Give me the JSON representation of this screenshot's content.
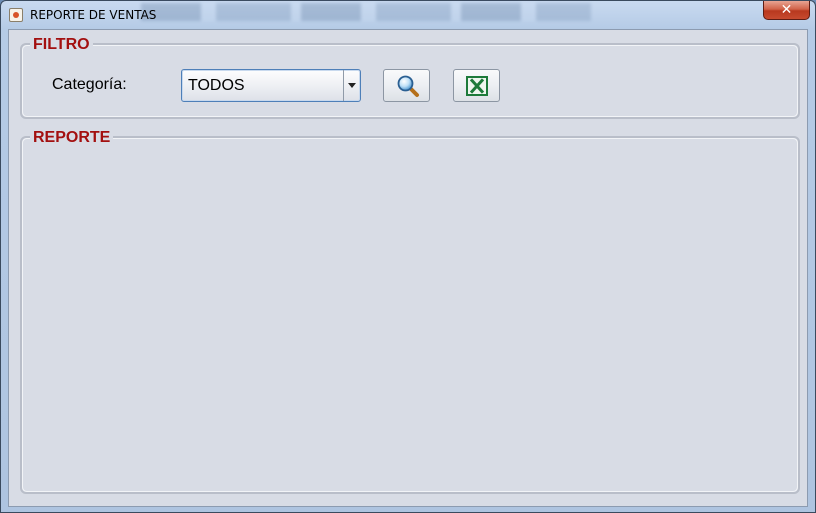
{
  "window": {
    "title": "REPORTE DE VENTAS",
    "close_glyph": "✕"
  },
  "filtro": {
    "legend": "FILTRO",
    "category_label": "Categoría:",
    "category_value": "TODOS",
    "search_icon": "search-icon",
    "export_icon": "excel-icon"
  },
  "reporte": {
    "legend": "REPORTE"
  },
  "colors": {
    "legend": "#a31010",
    "panel_bg": "#d8dce5",
    "excel_green": "#1d7a3a"
  }
}
